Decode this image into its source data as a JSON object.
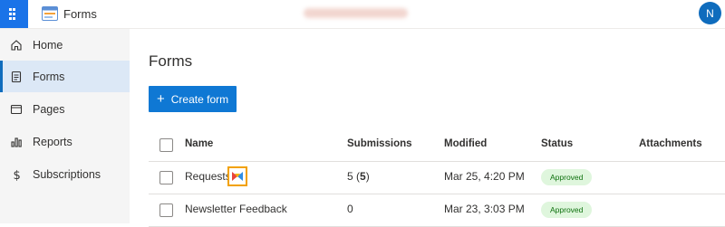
{
  "header": {
    "app_title": "Forms",
    "avatar_initial": "N",
    "accent": "#1a73e8"
  },
  "sidebar": {
    "items": [
      {
        "label": "Home",
        "icon": "home-icon"
      },
      {
        "label": "Forms",
        "icon": "forms-icon",
        "active": true
      },
      {
        "label": "Pages",
        "icon": "pages-icon"
      },
      {
        "label": "Reports",
        "icon": "reports-icon"
      },
      {
        "label": "Subscriptions",
        "icon": "dollar-icon"
      }
    ]
  },
  "main": {
    "title": "Forms",
    "create_button": "Create form",
    "table": {
      "columns": [
        "Name",
        "Submissions",
        "Modified",
        "Status",
        "Attachments"
      ],
      "rows": [
        {
          "name": "Requests",
          "submissions_total": "5",
          "submissions_new": "5",
          "modified": "Mar 25, 4:20 PM",
          "status": "Approved"
        },
        {
          "name": "Newsletter Feedback",
          "submissions_total": "0",
          "modified": "Mar 23, 3:03 PM",
          "status": "Approved"
        }
      ]
    },
    "colors": {
      "primary_button": "#0f78d4",
      "approved_bg": "#dff6dd",
      "approved_text": "#0e700e"
    }
  }
}
